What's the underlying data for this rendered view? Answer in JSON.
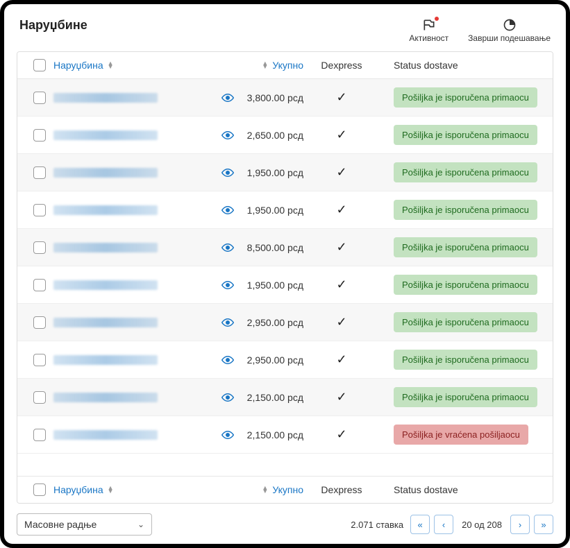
{
  "header": {
    "title": "Наруџбине",
    "actions": {
      "activity": "Активност",
      "finish_setup": "Заврши подешавање"
    }
  },
  "columns": {
    "order": "Наруџбина",
    "total": "Укупно",
    "dexpress": "Dexpress",
    "status": "Status dostave"
  },
  "status_labels": {
    "delivered": "Pošiljka je isporučena primaocu",
    "returned": "Pošiljka je vraćena pošiljaocu"
  },
  "rows": [
    {
      "amount": "3,800.00 рсд",
      "dexpress": true,
      "status": "delivered"
    },
    {
      "amount": "2,650.00 рсд",
      "dexpress": true,
      "status": "delivered"
    },
    {
      "amount": "1,950.00 рсд",
      "dexpress": true,
      "status": "delivered"
    },
    {
      "amount": "1,950.00 рсд",
      "dexpress": true,
      "status": "delivered"
    },
    {
      "amount": "8,500.00 рсд",
      "dexpress": true,
      "status": "delivered"
    },
    {
      "amount": "1,950.00 рсд",
      "dexpress": true,
      "status": "delivered"
    },
    {
      "amount": "2,950.00 рсд",
      "dexpress": true,
      "status": "delivered"
    },
    {
      "amount": "2,950.00 рсд",
      "dexpress": true,
      "status": "delivered"
    },
    {
      "amount": "2,150.00 рсд",
      "dexpress": true,
      "status": "delivered"
    },
    {
      "amount": "2,150.00 рсд",
      "dexpress": true,
      "status": "returned"
    }
  ],
  "footer": {
    "bulk_actions": "Масовне радње",
    "items_count": "2.071 ставка",
    "page_info": "20 од 208"
  }
}
